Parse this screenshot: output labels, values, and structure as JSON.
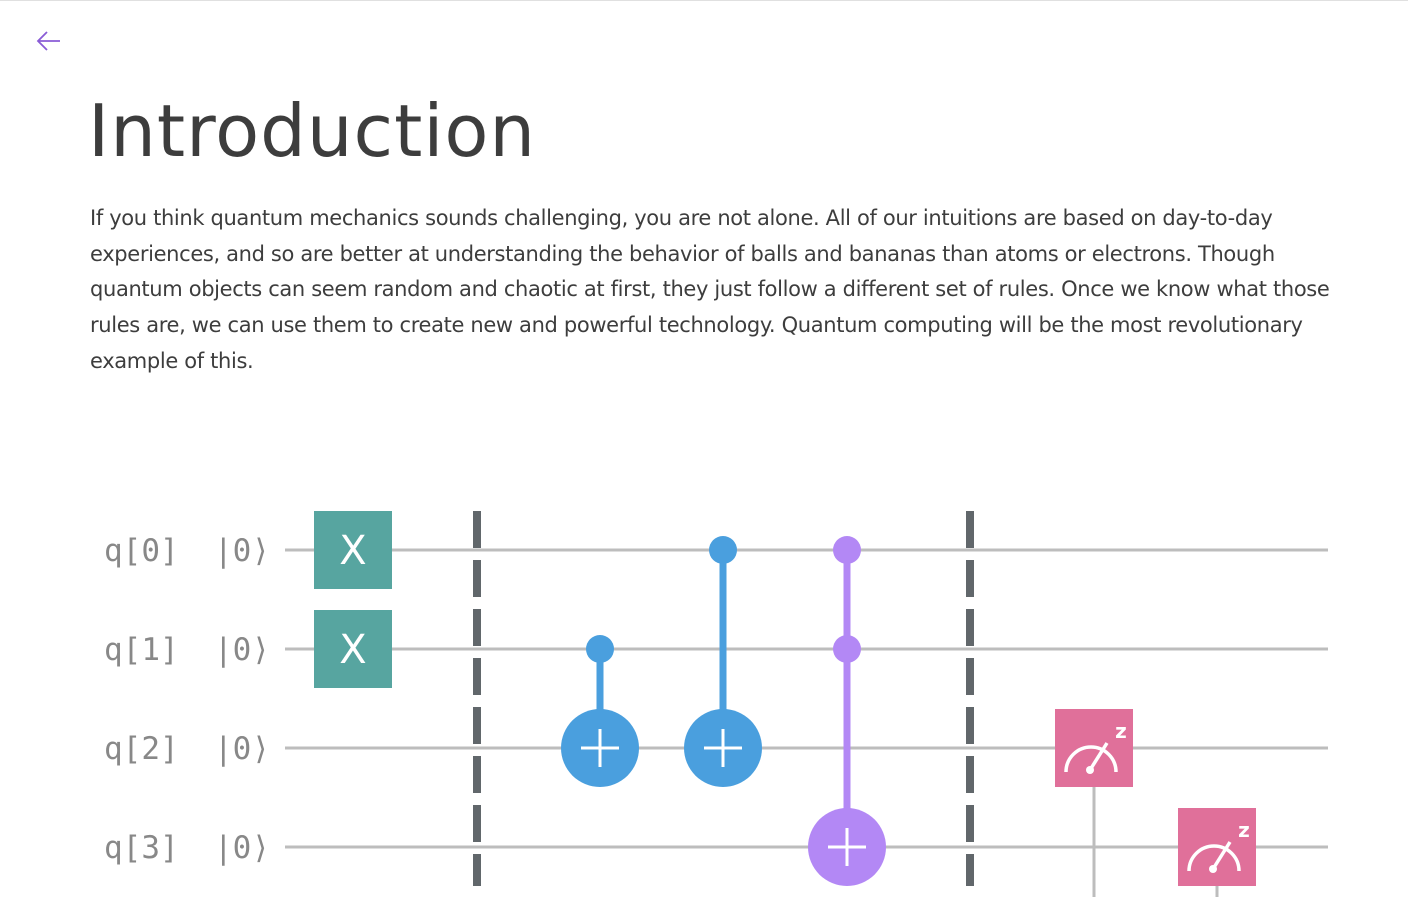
{
  "nav": {
    "back_icon": "arrow-left-icon"
  },
  "title": "Introduction",
  "intro": "If you think quantum mechanics sounds challenging, you are not alone. All of our intuitions are based on day-to-day experiences, and so are better at understanding the behavior of balls and bananas than atoms or electrons. Though quantum objects can seem random and chaotic at first, they just follow a different set of rules. Once we know what those rules are, we can use them to create new and powerful technology. Quantum computing will be the most revolutionary example of this.",
  "circuit": {
    "qubits": [
      {
        "name": "q[0]",
        "init": "|0⟩"
      },
      {
        "name": "q[1]",
        "init": "|0⟩"
      },
      {
        "name": "q[2]",
        "init": "|0⟩"
      },
      {
        "name": "q[3]",
        "init": "|0⟩"
      }
    ],
    "x_gate_label": "X",
    "measure_label": "z",
    "colors": {
      "x": "#57a5a0",
      "cnot": "#4a9fde",
      "toffoli": "#b388f5",
      "measure": "#e0709a",
      "barrier": "#61676b",
      "wire": "#bdbdbd"
    }
  }
}
